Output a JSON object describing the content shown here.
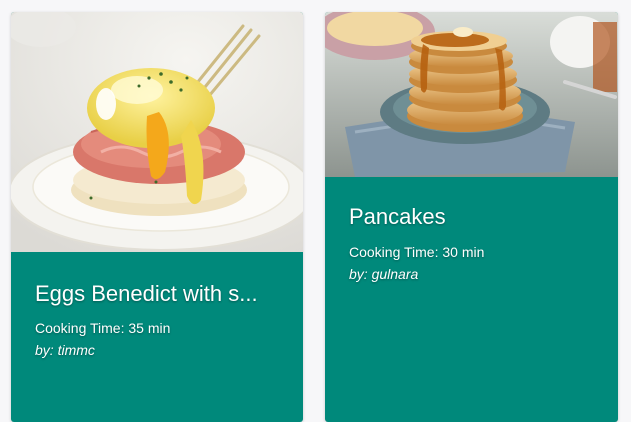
{
  "colors": {
    "page_background": "#f7f7f9",
    "card_background": "#00897b",
    "text": "#ffffff"
  },
  "recipes": [
    {
      "title": "Eggs Benedict with s...",
      "cooking_time": "Cooking Time: 35 min",
      "author": "by: timmc",
      "image_subject": "eggs-benedict-with-salmon-photo"
    },
    {
      "title": "Pancakes",
      "cooking_time": "Cooking Time: 30 min",
      "author": "by: gulnara",
      "image_subject": "pancake-stack-photo"
    }
  ]
}
